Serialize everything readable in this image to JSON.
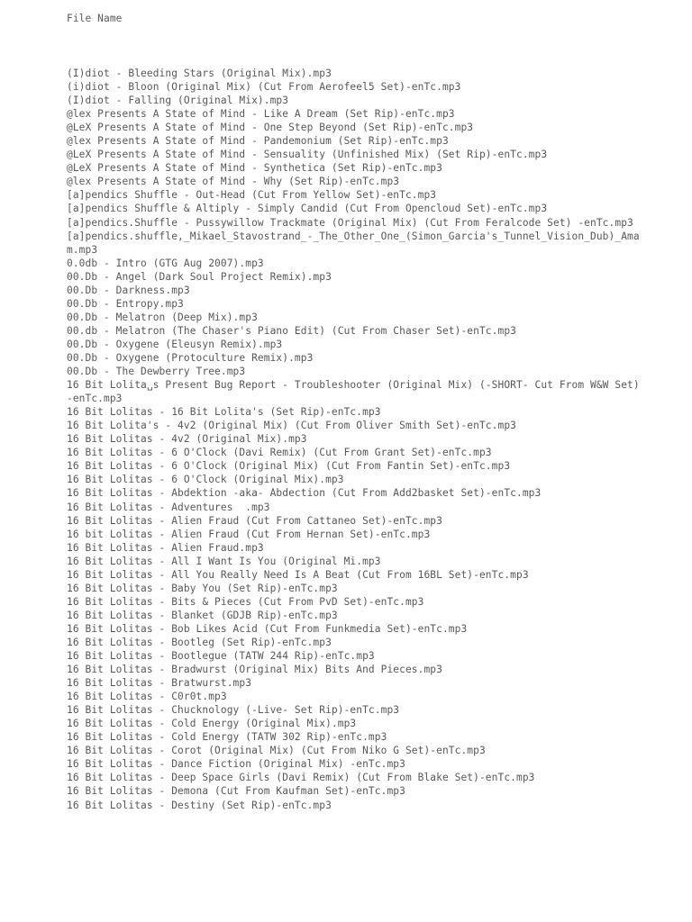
{
  "document": {
    "column_header": "File Name",
    "text_color": "#575757",
    "background_color": "#ffffff",
    "lines": [
      "(I)diot - Bleeding Stars (Original Mix).mp3",
      "(i)diot - Bloon (Original Mix) (Cut From Aerofeel5 Set)-enTc.mp3",
      "(I)diot - Falling (Original Mix).mp3",
      "@lex Presents A State of Mind - Like A Dream (Set Rip)-enTc.mp3",
      "@LeX Presents A State of Mind - One Step Beyond (Set Rip)-enTc.mp3",
      "@lex Presents A State of Mind - Pandemonium (Set Rip)-enTc.mp3",
      "@LeX Presents A State of Mind - Sensuality (Unfinished Mix) (Set Rip)-enTc.mp3",
      "@LeX Presents A State of Mind - Synthetica (Set Rip)-enTc.mp3",
      "@lex Presents A State of Mind - Why (Set Rip)-enTc.mp3",
      "[a]pendics Shuffle - Out-Head (Cut From Yellow Set)-enTc.mp3",
      "[a]pendics Shuffle & Altiply - Simply Candid (Cut From Opencloud Set)-enTc.mp3",
      "[a]pendics.Shuffle - Pussywillow Trackmate (Original Mix) (Cut From Feralcode Set) -enTc.mp3",
      "[a]pendics.shuffle,_Mikael_Stavostrand_-_The_Other_One_(Simon_Garcia's_Tunnel_Vision_Dub)_Amam.mp3",
      "0.0db - Intro (GTG Aug 2007).mp3",
      "00.Db - Angel (Dark Soul Project Remix).mp3",
      "00.Db - Darkness.mp3",
      "00.Db - Entropy.mp3",
      "00.Db - Melatron (Deep Mix).mp3",
      "00.db - Melatron (The Chaser's Piano Edit) (Cut From Chaser Set)-enTc.mp3",
      "00.Db - Oxygene (Eleusyn Remix).mp3",
      "00.Db - Oxygene (Protoculture Remix).mp3",
      "00.Db - The Dewberry Tree.mp3",
      "16 Bit Lolita␣s Present Bug Report - Troubleshooter (Original Mix) (-SHORT- Cut From W&W Set)-enTc.mp3",
      "16 Bit Lolitas - 16 Bit Lolita's (Set Rip)-enTc.mp3",
      "16 Bit Lolita's - 4v2 (Original Mix) (Cut From Oliver Smith Set)-enTc.mp3",
      "16 Bit Lolitas - 4v2 (Original Mix).mp3",
      "16 Bit Lolitas - 6 O'Clock (Davi Remix) (Cut From Grant Set)-enTc.mp3",
      "16 Bit Lolitas - 6 O'Clock (Original Mix) (Cut From Fantin Set)-enTc.mp3",
      "16 Bit Lolitas - 6 O'Clock (Original Mix).mp3",
      "16 Bit Lolitas - Abdektion -aka- Abdection (Cut From Add2basket Set)-enTc.mp3",
      "16 Bit Lolitas - Adventures  .mp3",
      "16 Bit Lolitas - Alien Fraud (Cut From Cattaneo Set)-enTc.mp3",
      "16 bit Lolitas - Alien Fraud (Cut From Hernan Set)-enTc.mp3",
      "16 Bit Lolitas - Alien Fraud.mp3",
      "16 Bit Lolitas - All I Want Is You (Original Mi.mp3",
      "16 Bit Lolitas - All You Really Need Is A Beat (Cut From 16BL Set)-enTc.mp3",
      "16 Bit Lolitas - Baby You (Set Rip)-enTc.mp3",
      "16 Bit Lolitas - Bits & Pieces (Cut From PvD Set)-enTc.mp3",
      "16 Bit Lolitas - Blanket (GDJB Rip)-enTc.mp3",
      "16 Bit Lolitas - Bob Likes Acid (Cut From Funkmedia Set)-enTc.mp3",
      "16 Bit Lolitas - Bootleg (Set Rip)-enTc.mp3",
      "16 Bit Lolitas - Bootlegue (TATW 244 Rip)-enTc.mp3",
      "16 Bit Lolitas - Bradwurst (Original Mix) Bits And Pieces.mp3",
      "16 Bit Lolitas - Bratwurst.mp3",
      "16 Bit Lolitas - C0r0t.mp3",
      "16 Bit Lolitas - Chucknology (-Live- Set Rip)-enTc.mp3",
      "16 Bit Lolitas - Cold Energy (Original Mix).mp3",
      "16 Bit Lolitas - Cold Energy (TATW 302 Rip)-enTc.mp3",
      "16 Bit Lolitas - Corot (Original Mix) (Cut From Niko G Set)-enTc.mp3",
      "16 Bit Lolitas - Dance Fiction (Original Mix) -enTc.mp3",
      "16 Bit Lolitas - Deep Space Girls (Davi Remix) (Cut From Blake Set)-enTc.mp3",
      "16 Bit Lolitas - Demona (Cut From Kaufman Set)-enTc.mp3",
      "16 Bit Lolitas - Destiny (Set Rip)-enTc.mp3"
    ]
  }
}
